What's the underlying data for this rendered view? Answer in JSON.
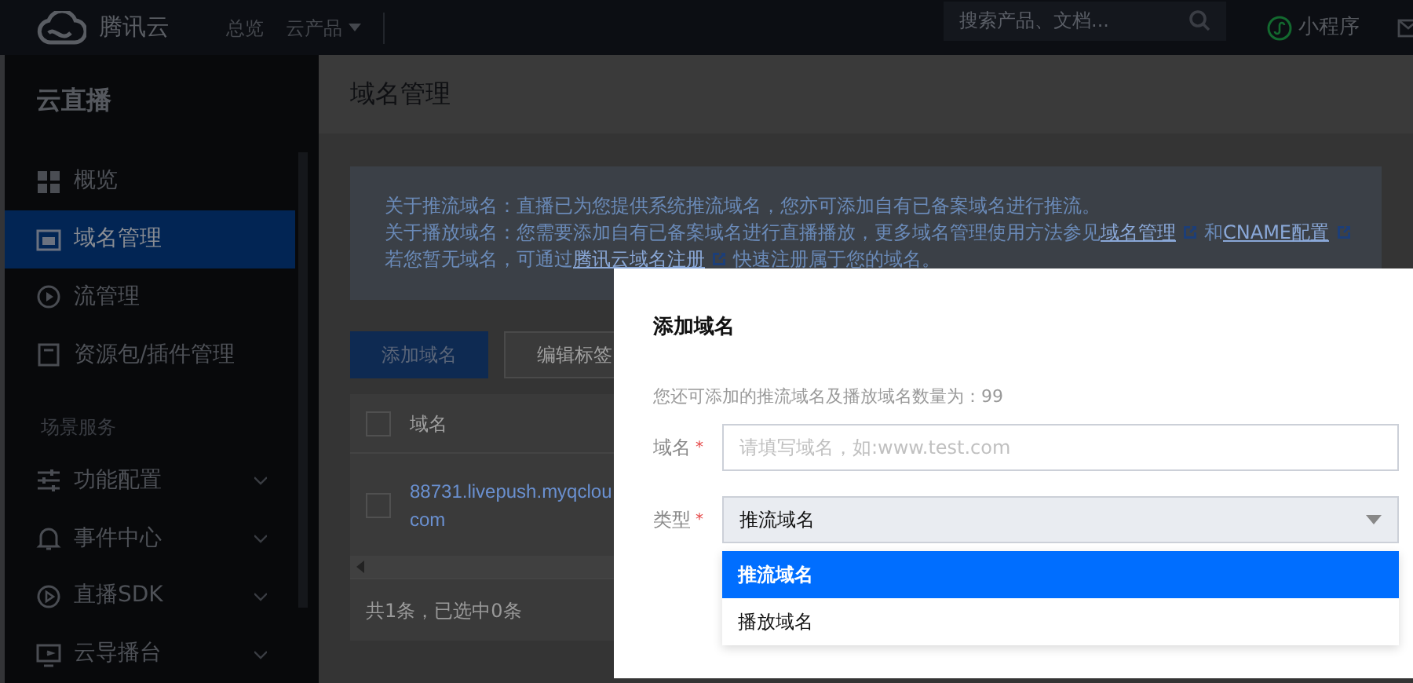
{
  "topbar": {
    "logo": "腾讯云",
    "nav": [
      {
        "label": "总览",
        "dropdown": false
      },
      {
        "label": "云产品",
        "dropdown": true
      }
    ],
    "search": {
      "placeholder": "搜索产品、文档..."
    },
    "mini_program": "小程序"
  },
  "sidebar": {
    "title": "云直播",
    "items": [
      {
        "label": "概览",
        "selected": false
      },
      {
        "label": "域名管理",
        "selected": true
      },
      {
        "label": "流管理",
        "selected": false
      },
      {
        "label": "资源包/插件管理",
        "selected": false
      }
    ],
    "section": "场景服务",
    "groups": [
      {
        "label": "功能配置",
        "expanded": false
      },
      {
        "label": "事件中心",
        "expanded": false
      },
      {
        "label": "直播SDK",
        "expanded": false
      },
      {
        "label": "云导播台",
        "expanded": false
      }
    ]
  },
  "page": {
    "title": "域名管理",
    "notice": [
      {
        "parts": [
          {
            "kind": "text",
            "text": "关于推流域名：直播已为您提供系统推流域名，您亦可添加自有已备案域名进行推流。"
          }
        ]
      },
      {
        "parts": [
          {
            "kind": "text",
            "text": "关于播放域名：您需要添加自有已备案域名进行直播播放，更多域名管理使用方法参见"
          },
          {
            "kind": "link",
            "text": "域名管理"
          },
          {
            "kind": "text",
            "text": "和"
          },
          {
            "kind": "link",
            "text": "CNAME配置"
          }
        ]
      },
      {
        "parts": [
          {
            "kind": "text",
            "text": "若您暂无域名，可通过"
          },
          {
            "kind": "link",
            "text": "腾讯云域名注册"
          },
          {
            "kind": "text",
            "text": "快速注册属于您的域名。"
          }
        ]
      }
    ],
    "buttons": [
      {
        "label": "添加域名",
        "kind": "primary"
      },
      {
        "label": "编辑标签",
        "kind": "default"
      }
    ],
    "table": {
      "columns": [
        "域名"
      ],
      "rows": [
        {
          "checked": false,
          "cells": [
            {
              "lines": [
                "88731.livepush.myqclou",
                "com"
              ]
            }
          ]
        }
      ],
      "header_checked": false,
      "footer": "共1条，已选中0条"
    }
  },
  "dialog": {
    "title": "添加域名",
    "note": "您还可添加的推流域名及播放域名数量为：99",
    "fields": [
      {
        "kind": "input",
        "label": "域名",
        "required_mark": "*",
        "placeholder": "请填写域名，如:www.test.com"
      },
      {
        "kind": "select",
        "label": "类型",
        "required_mark": "*",
        "value": "推流域名",
        "options": [
          {
            "label": "推流域名",
            "selected": true
          },
          {
            "label": "播放域名",
            "selected": false
          }
        ]
      }
    ]
  }
}
